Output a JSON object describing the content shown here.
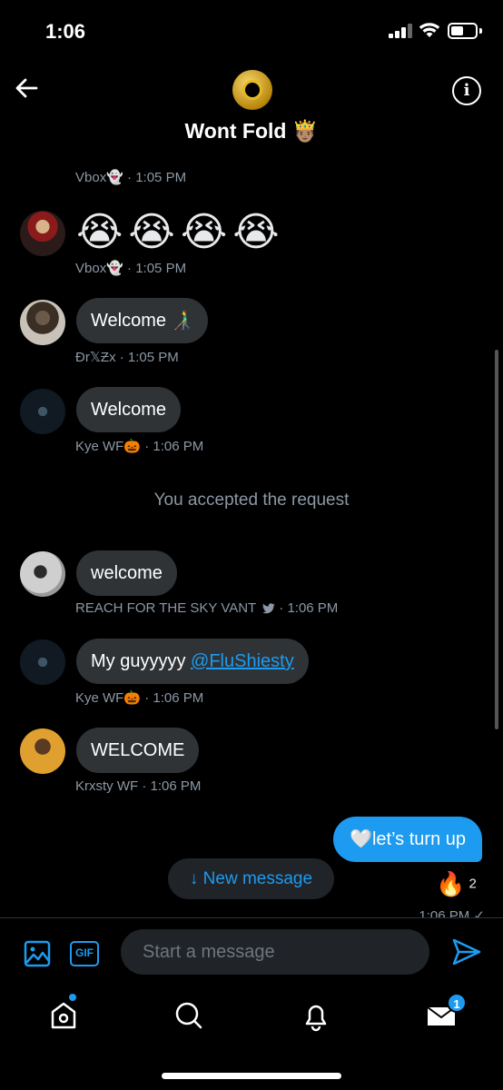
{
  "status_bar": {
    "time": "1:06"
  },
  "header": {
    "title": "Wont Fold 🤴🏽"
  },
  "messages": [
    {
      "sender": "Vbox👻",
      "time": "· 1:05 PM"
    },
    {
      "emojis": "😭😭😭😭",
      "sender": "Vbox👻",
      "time": "· 1:05 PM"
    },
    {
      "text": "Welcome 👨‍🦯",
      "sender": "Ɖr𝕏Ƶx",
      "time": "· 1:05 PM"
    },
    {
      "text": "Welcome",
      "sender": "Kye WF🎃",
      "time": "· 1:06 PM"
    },
    {
      "system": "You accepted the request"
    },
    {
      "text": "welcome",
      "sender": "REACH FOR THE SKY VANT",
      "sender_icon": "bird-icon",
      "time": "· 1:06 PM"
    },
    {
      "text_prefix": "My guyyyyy",
      "mention": "@FluShiesty",
      "sender": "Kye WF🎃",
      "time": "· 1:06 PM"
    },
    {
      "text": "WELCOME",
      "sender": "Krxsty WF",
      "time": "· 1:06 PM"
    }
  ],
  "sent_message": {
    "text": "🤍let’s turn up",
    "reaction_emoji": "🔥",
    "reaction_count": "2",
    "time": "1:06 PM ✓"
  },
  "new_message_pill": "↓ New message",
  "composer": {
    "placeholder": "Start a message",
    "gif_label": "GIF"
  },
  "tab_bar": {
    "messages_badge": "1"
  },
  "colors": {
    "accent": "#1d9bf0",
    "bubble": "#2f3336",
    "meta": "#8b98a5",
    "background": "#000000"
  }
}
